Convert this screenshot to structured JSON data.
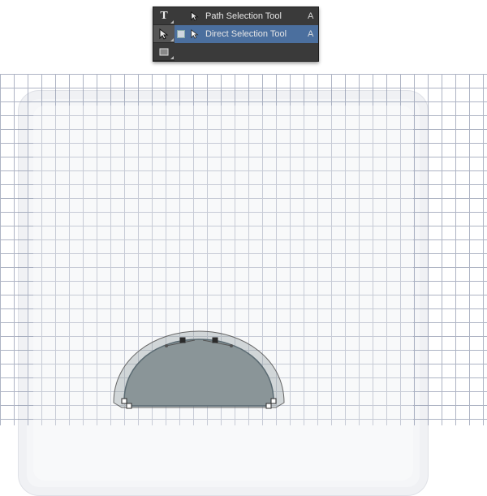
{
  "toolbar": {
    "slots": {
      "type_tool": "T",
      "path_selection": "arrow-black",
      "rectangle": "rect"
    }
  },
  "flyout": {
    "items": [
      {
        "label": "Path Selection Tool",
        "shortcut": "A",
        "active": false
      },
      {
        "label": "Direct Selection Tool",
        "shortcut": "A",
        "active": true
      }
    ]
  },
  "canvas": {
    "grid_spacing_px": 17,
    "shape_fill": "#8a9598",
    "shape_outline": "#5a6a72",
    "path_stroke": "#666"
  }
}
